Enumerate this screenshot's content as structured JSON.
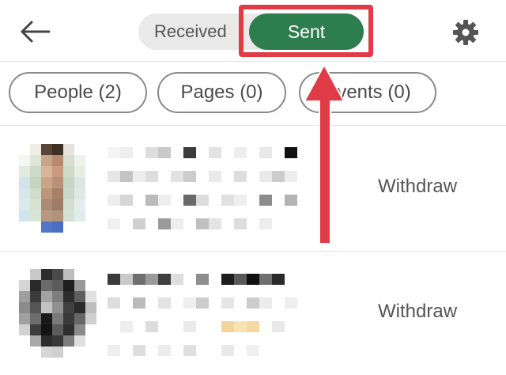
{
  "header": {
    "back_icon": "arrow-left-icon",
    "tabs": [
      {
        "label": "Received",
        "selected": false
      },
      {
        "label": "Sent",
        "selected": true
      }
    ],
    "settings_icon": "gear-icon"
  },
  "filters": [
    {
      "label": "People (2)"
    },
    {
      "label": "Pages (0)"
    },
    {
      "label": "Events (0)"
    }
  ],
  "invitations": [
    {
      "action_label": "Withdraw"
    },
    {
      "action_label": "Withdraw"
    }
  ],
  "colors": {
    "accent_green": "#2e7d4f",
    "annotation_red": "#e03c48"
  }
}
